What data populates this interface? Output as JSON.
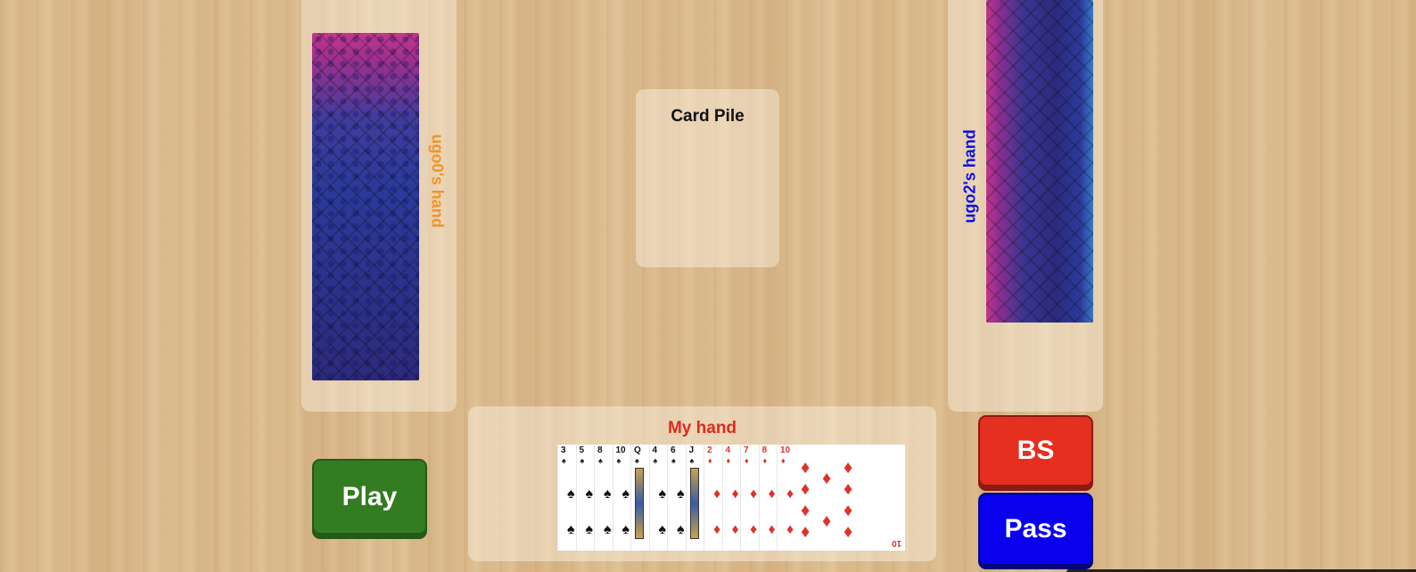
{
  "table": {
    "card_pile_title": "Card Pile",
    "my_hand_title": "My hand"
  },
  "players": {
    "left": {
      "label": "ugo0's hand",
      "color": "#f0952c"
    },
    "right": {
      "label": "ugo2's hand",
      "color": "#1010e0"
    }
  },
  "buttons": {
    "play": {
      "label": "Play",
      "color": "#347c22"
    },
    "bs": {
      "label": "BS",
      "color": "#e5301f"
    },
    "pass": {
      "label": "Pass",
      "color": "#0a00ee"
    }
  },
  "my_hand": [
    {
      "rank": "3",
      "suit": "♠",
      "color": "black"
    },
    {
      "rank": "5",
      "suit": "♠",
      "color": "black"
    },
    {
      "rank": "8",
      "suit": "♠",
      "color": "black"
    },
    {
      "rank": "10",
      "suit": "♠",
      "color": "black"
    },
    {
      "rank": "Q",
      "suit": "♠",
      "color": "black",
      "face": true
    },
    {
      "rank": "4",
      "suit": "♠",
      "color": "black"
    },
    {
      "rank": "6",
      "suit": "♠",
      "color": "black"
    },
    {
      "rank": "J",
      "suit": "♠",
      "color": "black",
      "face": true
    },
    {
      "rank": "2",
      "suit": "♦",
      "color": "red"
    },
    {
      "rank": "4",
      "suit": "♦",
      "color": "red"
    },
    {
      "rank": "7",
      "suit": "♦",
      "color": "red"
    },
    {
      "rank": "8",
      "suit": "♦",
      "color": "red"
    },
    {
      "rank": "10",
      "suit": "♦",
      "color": "red"
    }
  ]
}
